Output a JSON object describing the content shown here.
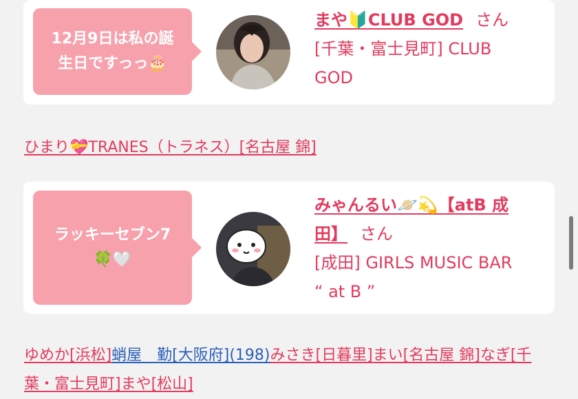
{
  "card1": {
    "bubble_line1": "12月9日は私の誕",
    "bubble_line2": "生日ですっっ🎂",
    "name": "まや🔰CLUB GOD",
    "honorific": "さん",
    "shop_line1": "[千葉・富士見町] CLUB",
    "shop_line2": "GOD"
  },
  "middle_link": "ひまり💝TRANES（トラネス）[名古屋 錦]",
  "card2": {
    "bubble_line1": "ラッキーセブン7",
    "bubble_line2": "🍀🤍",
    "name_line1": "みゃんるい🪐💫【atB 成",
    "name_line2": "田】",
    "honorific": "さん",
    "shop_line1": "[成田] GIRLS MUSIC BAR",
    "shop_line2": "“ at B ”"
  },
  "bottom_links": {
    "l1": "ゆめか[浜松]",
    "l2": "蛸屋　勤[大阪府](198)",
    "l3": "みさき[日暮里]",
    "l4": "まい[名古屋 錦]",
    "l5": "なぎ[千葉・富士見町]",
    "l6": "まや[松山]"
  },
  "colors": {
    "accent": "#e33a5d",
    "bubble": "#f6a1ac",
    "background": "#f2f2f2",
    "link_blue": "#2a5fb8"
  },
  "icons": {
    "avatar1": "user-photo",
    "avatar2": "user-photo-with-sticker"
  }
}
